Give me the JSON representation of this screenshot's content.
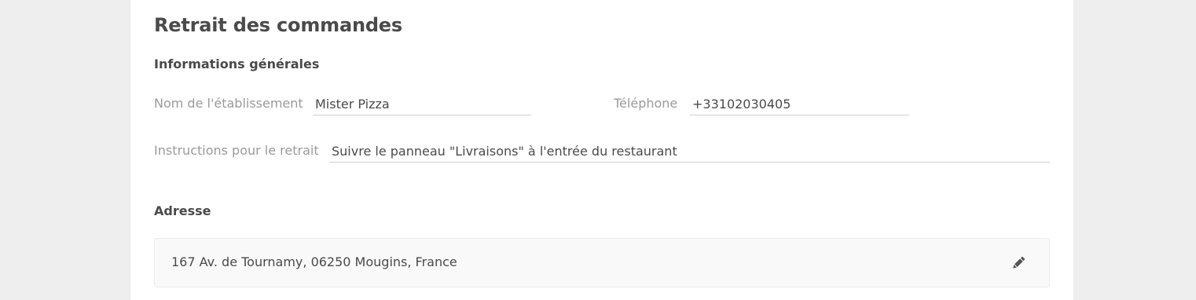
{
  "page": {
    "title": "Retrait des commandes"
  },
  "general": {
    "section_title": "Informations générales",
    "name_label": "Nom de l'établissement",
    "name_value": "Mister Pizza",
    "phone_label": "Téléphone",
    "phone_value": "+33102030405",
    "instructions_label": "Instructions pour le retrait",
    "instructions_value": "Suivre le panneau \"Livraisons\" à l'entrée du restaurant"
  },
  "address": {
    "section_title": "Adresse",
    "value": "167 Av. de Tournamy, 06250 Mougins, France",
    "edit_icon": "pencil-icon"
  },
  "colors": {
    "background": "#eeeeee",
    "card": "#ffffff",
    "text": "#4a4a4a",
    "label": "#9a9a9a"
  }
}
